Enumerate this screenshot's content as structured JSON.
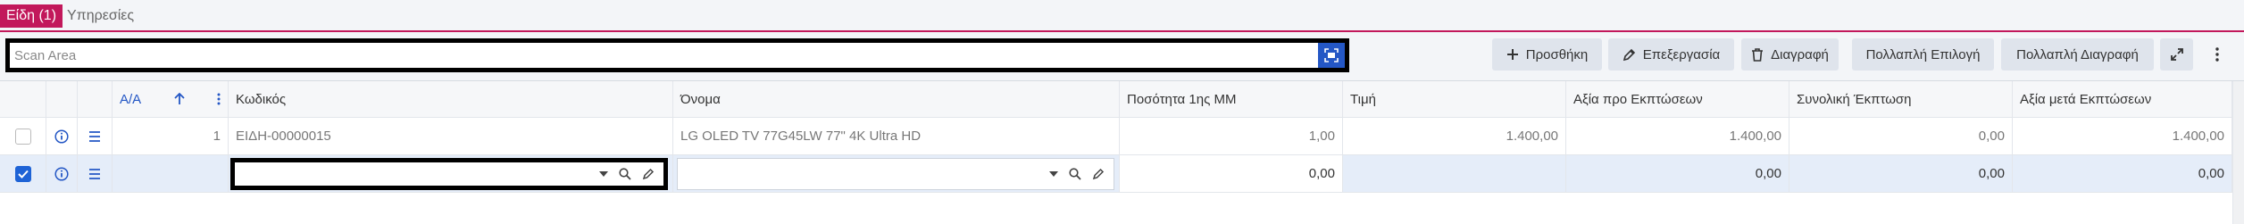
{
  "tabs": [
    {
      "label": "Είδη (1)",
      "active": true
    },
    {
      "label": "Υπηρεσίες",
      "active": false
    }
  ],
  "toolbar": {
    "scan_placeholder": "Scan Area",
    "add_label": "Προσθήκη",
    "edit_label": "Επεξεργασία",
    "delete_label": "Διαγραφή",
    "multi_select_label": "Πολλαπλή Επιλογή",
    "multi_delete_label": "Πολλαπλή Διαγραφή"
  },
  "grid": {
    "columns": {
      "aa": "Α/Α",
      "code": "Κωδικός",
      "name": "Όνομα",
      "qty": "Ποσότητα 1ης ΜΜ",
      "price": "Τιμή",
      "value_before": "Αξία προ Εκπτώσεων",
      "total_discount": "Συνολική Έκπτωση",
      "value_after": "Αξία μετά Εκπτώσεων"
    },
    "rows": [
      {
        "checked": false,
        "aa": "1",
        "code": "ΕΙΔΗ-00000015",
        "name": "LG OLED TV 77G45LW 77\" 4K Ultra HD",
        "qty": "1,00",
        "price": "1.400,00",
        "value_before": "1.400,00",
        "total_discount": "0,00",
        "value_after": "1.400,00"
      },
      {
        "checked": true,
        "aa": "",
        "code": "",
        "name": "",
        "qty": "0,00",
        "price": "",
        "value_before": "0,00",
        "total_discount": "0,00",
        "value_after": "0,00"
      }
    ]
  },
  "colors": {
    "accent": "#c2185b",
    "primary_blue": "#2457c5",
    "selected_row": "#e5edf9"
  }
}
